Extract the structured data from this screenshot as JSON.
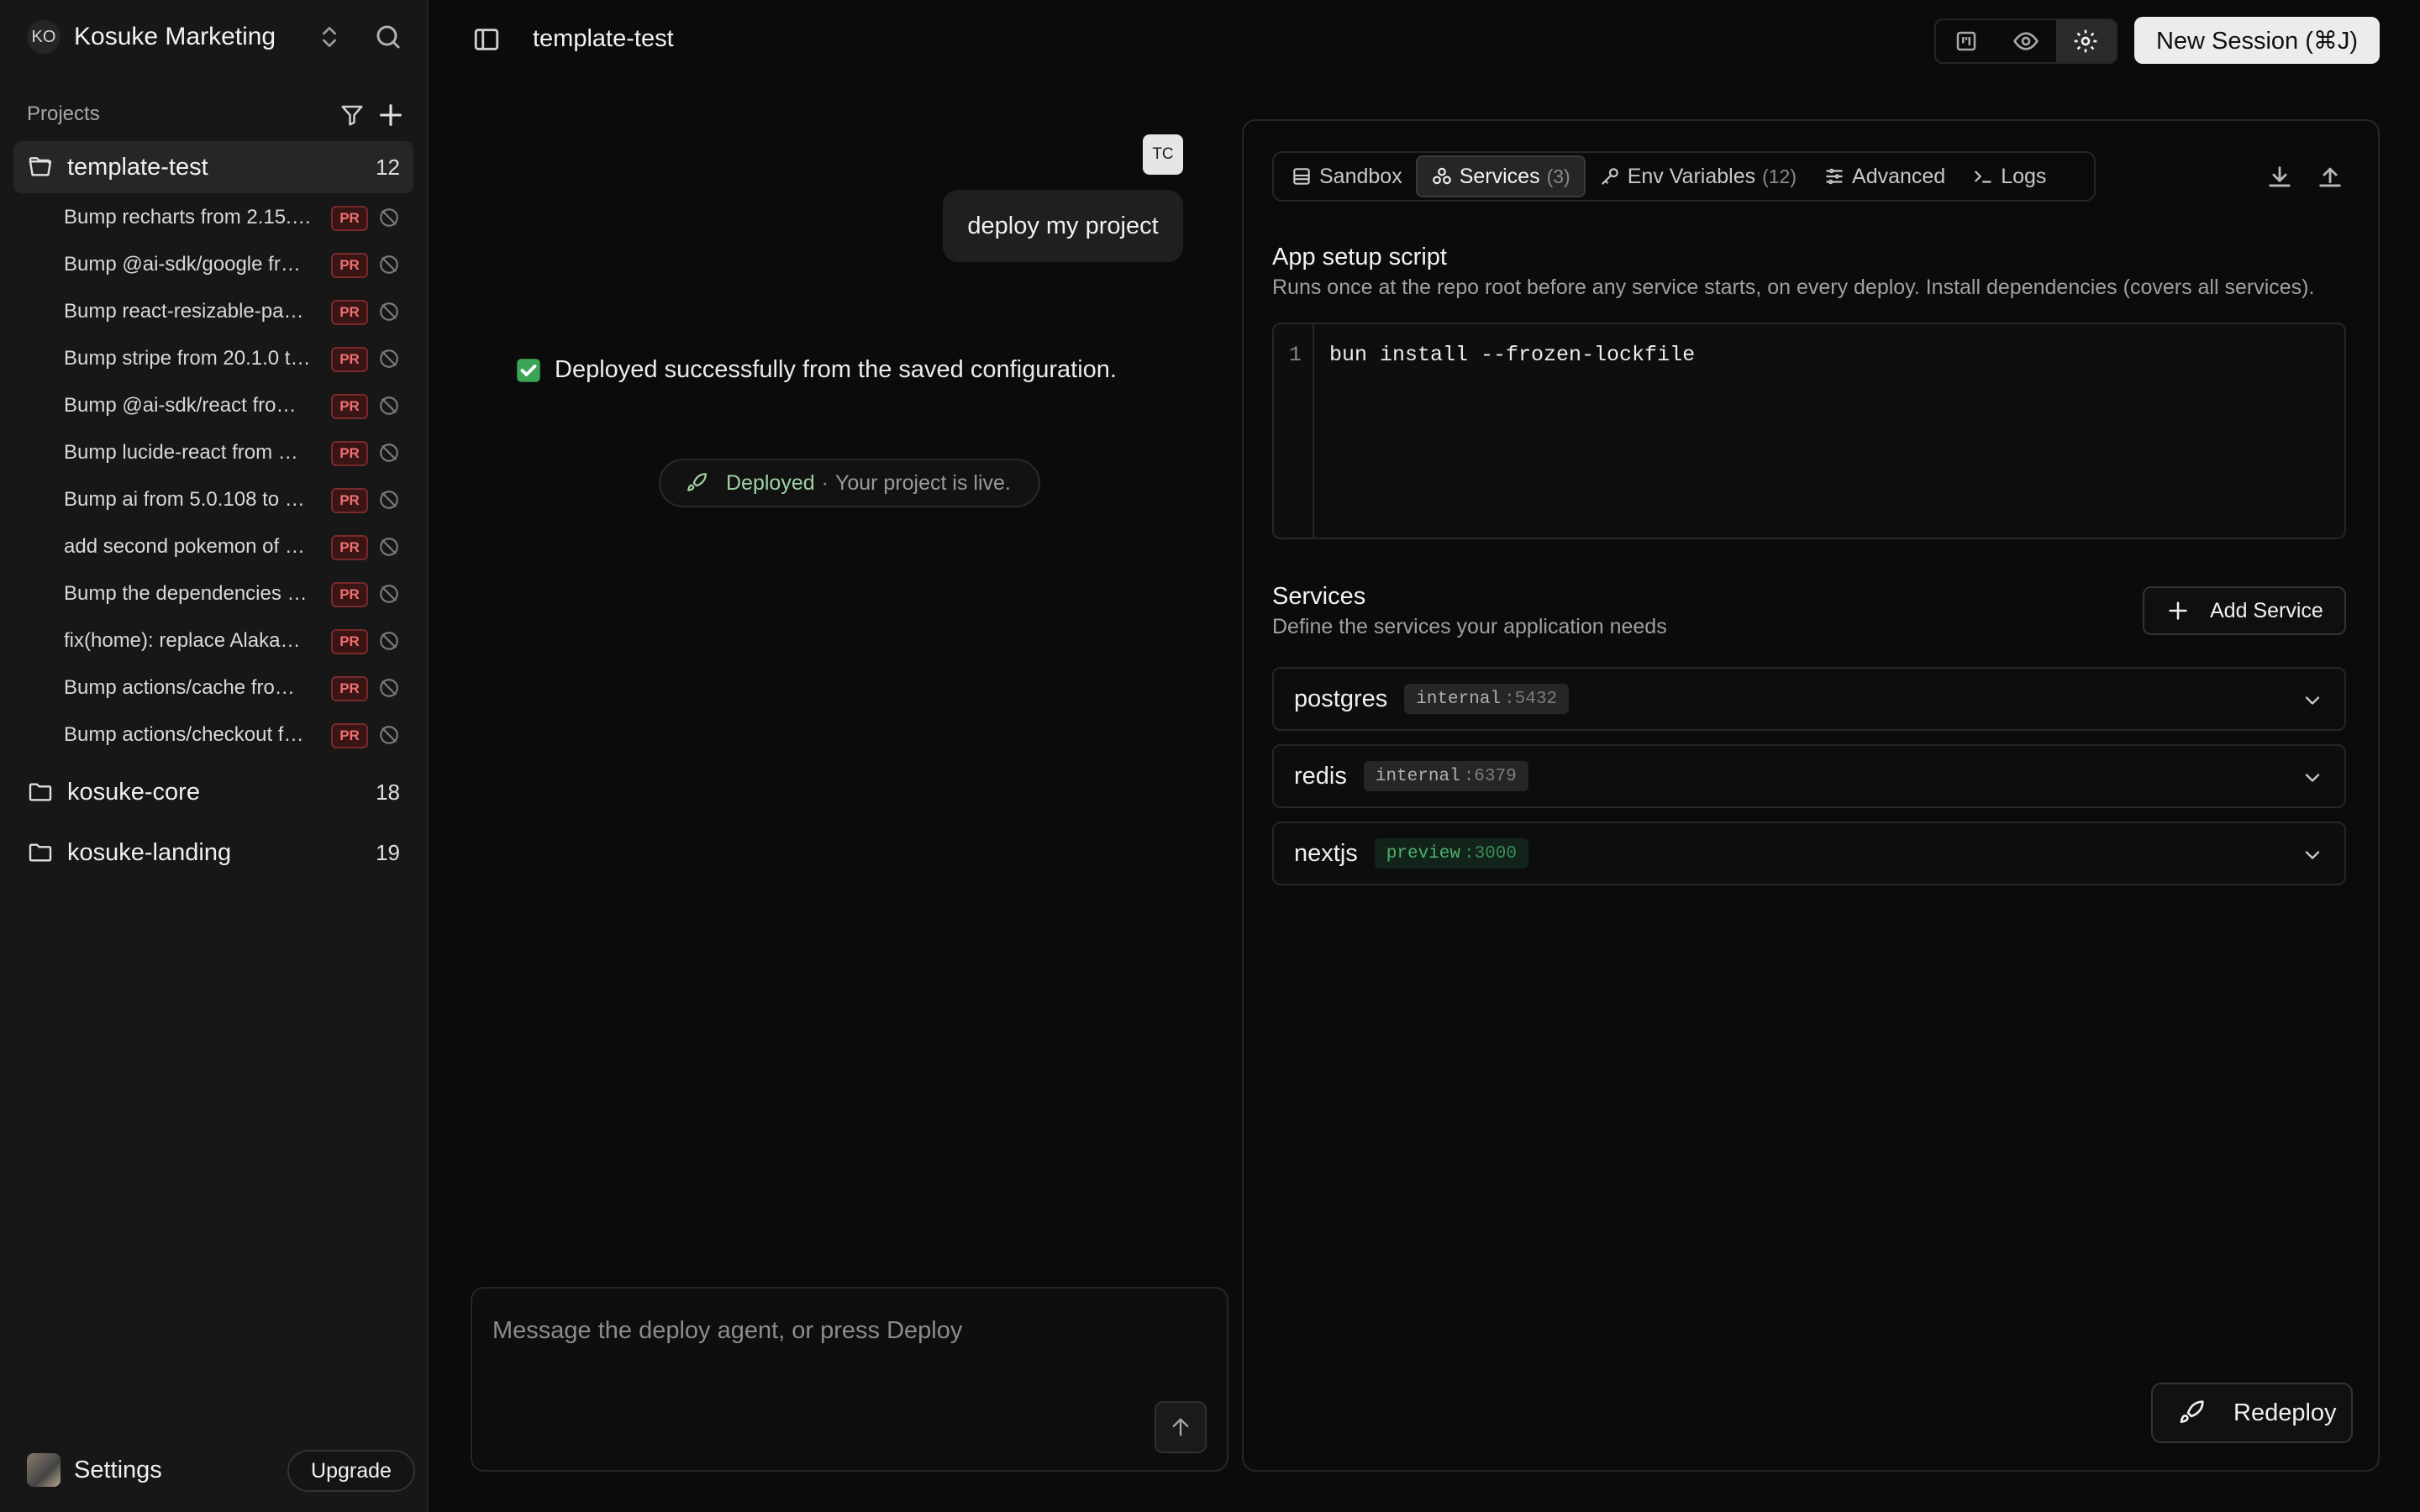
{
  "workspace": {
    "initials": "KO",
    "name": "Kosuke Marketing"
  },
  "sidebar": {
    "projects_label": "Projects",
    "projects": [
      {
        "name": "template-test",
        "count": "12"
      },
      {
        "name": "kosuke-core",
        "count": "18"
      },
      {
        "name": "kosuke-landing",
        "count": "19"
      }
    ],
    "sessions": [
      {
        "title": "Bump recharts from 2.15.…",
        "badge": "PR"
      },
      {
        "title": "Bump @ai-sdk/google fr…",
        "badge": "PR"
      },
      {
        "title": "Bump react-resizable-pa…",
        "badge": "PR"
      },
      {
        "title": "Bump stripe from 20.1.0 t…",
        "badge": "PR"
      },
      {
        "title": "Bump @ai-sdk/react fro…",
        "badge": "PR"
      },
      {
        "title": "Bump lucide-react from …",
        "badge": "PR"
      },
      {
        "title": "Bump ai from 5.0.108 to …",
        "badge": "PR"
      },
      {
        "title": "add second pokemon of …",
        "badge": "PR"
      },
      {
        "title": "Bump the dependencies …",
        "badge": "PR"
      },
      {
        "title": "fix(home): replace Alaka…",
        "badge": "PR"
      },
      {
        "title": "Bump actions/cache fro…",
        "badge": "PR"
      },
      {
        "title": "Bump actions/checkout f…",
        "badge": "PR"
      }
    ],
    "settings_label": "Settings",
    "upgrade_label": "Upgrade"
  },
  "header": {
    "title": "template-test",
    "new_session_label": "New Session (⌘J)"
  },
  "chat": {
    "user_initials": "TC",
    "user_message": "deploy my project",
    "assistant_emoji": "✅",
    "assistant_message": "Deployed successfully from the saved configuration.",
    "status_pill": {
      "status": "Deployed",
      "separator": "·",
      "detail": "Your project is live."
    },
    "composer_placeholder": "Message the deploy agent, or press Deploy"
  },
  "panel": {
    "tabs": [
      {
        "label": "Sandbox",
        "count": ""
      },
      {
        "label": "Services",
        "count": "(3)"
      },
      {
        "label": "Env Variables",
        "count": "(12)"
      },
      {
        "label": "Advanced",
        "count": ""
      },
      {
        "label": "Logs",
        "count": ""
      }
    ],
    "setup": {
      "title": "App setup script",
      "description": "Runs once at the repo root before any service starts, on every deploy. Install dependencies (covers all services).",
      "line_number": "1",
      "code": "bun install --frozen-lockfile"
    },
    "services": {
      "title": "Services",
      "description": "Define the services your application needs",
      "add_label": "Add Service",
      "items": [
        {
          "name": "postgres",
          "type": "internal",
          "port": ":5432"
        },
        {
          "name": "redis",
          "type": "internal",
          "port": ":6379"
        },
        {
          "name": "nextjs",
          "type": "preview",
          "port": ":3000"
        }
      ]
    },
    "redeploy_label": "Redeploy"
  },
  "colors": {
    "background": "#0b0b0b",
    "sidebar": "#171717",
    "pr_badge": "#f07070",
    "deployed_status": "#9fd2a6",
    "preview_tag": "#4caf6a"
  },
  "icons": [
    "chevrons-up-down-icon",
    "search-icon",
    "filter-icon",
    "plus-icon",
    "folder-open-icon",
    "folder-icon",
    "git-pull-request-closed-icon",
    "sidebar-toggle-icon",
    "kanban-icon",
    "eye-icon",
    "gear-icon",
    "check-box-icon",
    "rocket-icon",
    "arrow-up-icon",
    "box-icon",
    "services-icon",
    "key-icon",
    "sliders-icon",
    "terminal-icon",
    "download-icon",
    "upload-icon",
    "chevron-down-icon"
  ]
}
